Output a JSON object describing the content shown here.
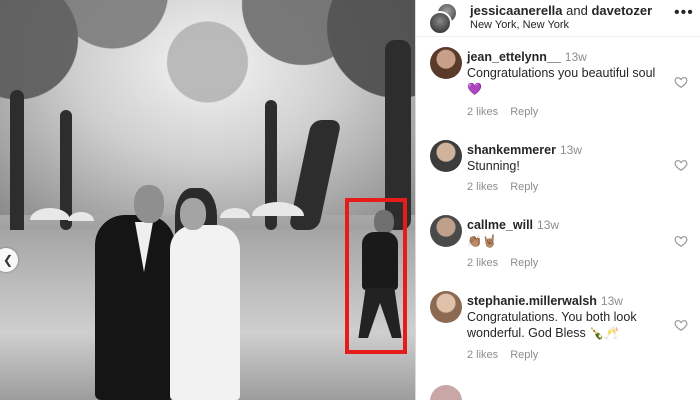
{
  "post": {
    "usernames": "jessicaanerella",
    "separator": " and ",
    "usernames2": "davetozer",
    "location": "New York, New York"
  },
  "comments": [
    {
      "username": "jean_ettelynn__",
      "time": "13w",
      "text": "Congratulations you beautiful soul",
      "emoji": "💜",
      "likes": "2 likes",
      "reply": "Reply"
    },
    {
      "username": "shankemmerer",
      "time": "13w",
      "text": "Stunning!",
      "emoji": "",
      "likes": "2 likes",
      "reply": "Reply"
    },
    {
      "username": "callme_will",
      "time": "13w",
      "text": "",
      "emoji": "👏🏽🤘🏽",
      "likes": "2 likes",
      "reply": "Reply"
    },
    {
      "username": "stephanie.millerwalsh",
      "time": "13w",
      "text": "Congratulations. You both look wonderful. God Bless",
      "emoji": "🍾🥂",
      "likes": "2 likes",
      "reply": "Reply"
    }
  ],
  "nav": {
    "prev_glyph": "❮"
  },
  "colors": {
    "highlight": "#e41c1c",
    "muted": "#8e8e8e"
  }
}
